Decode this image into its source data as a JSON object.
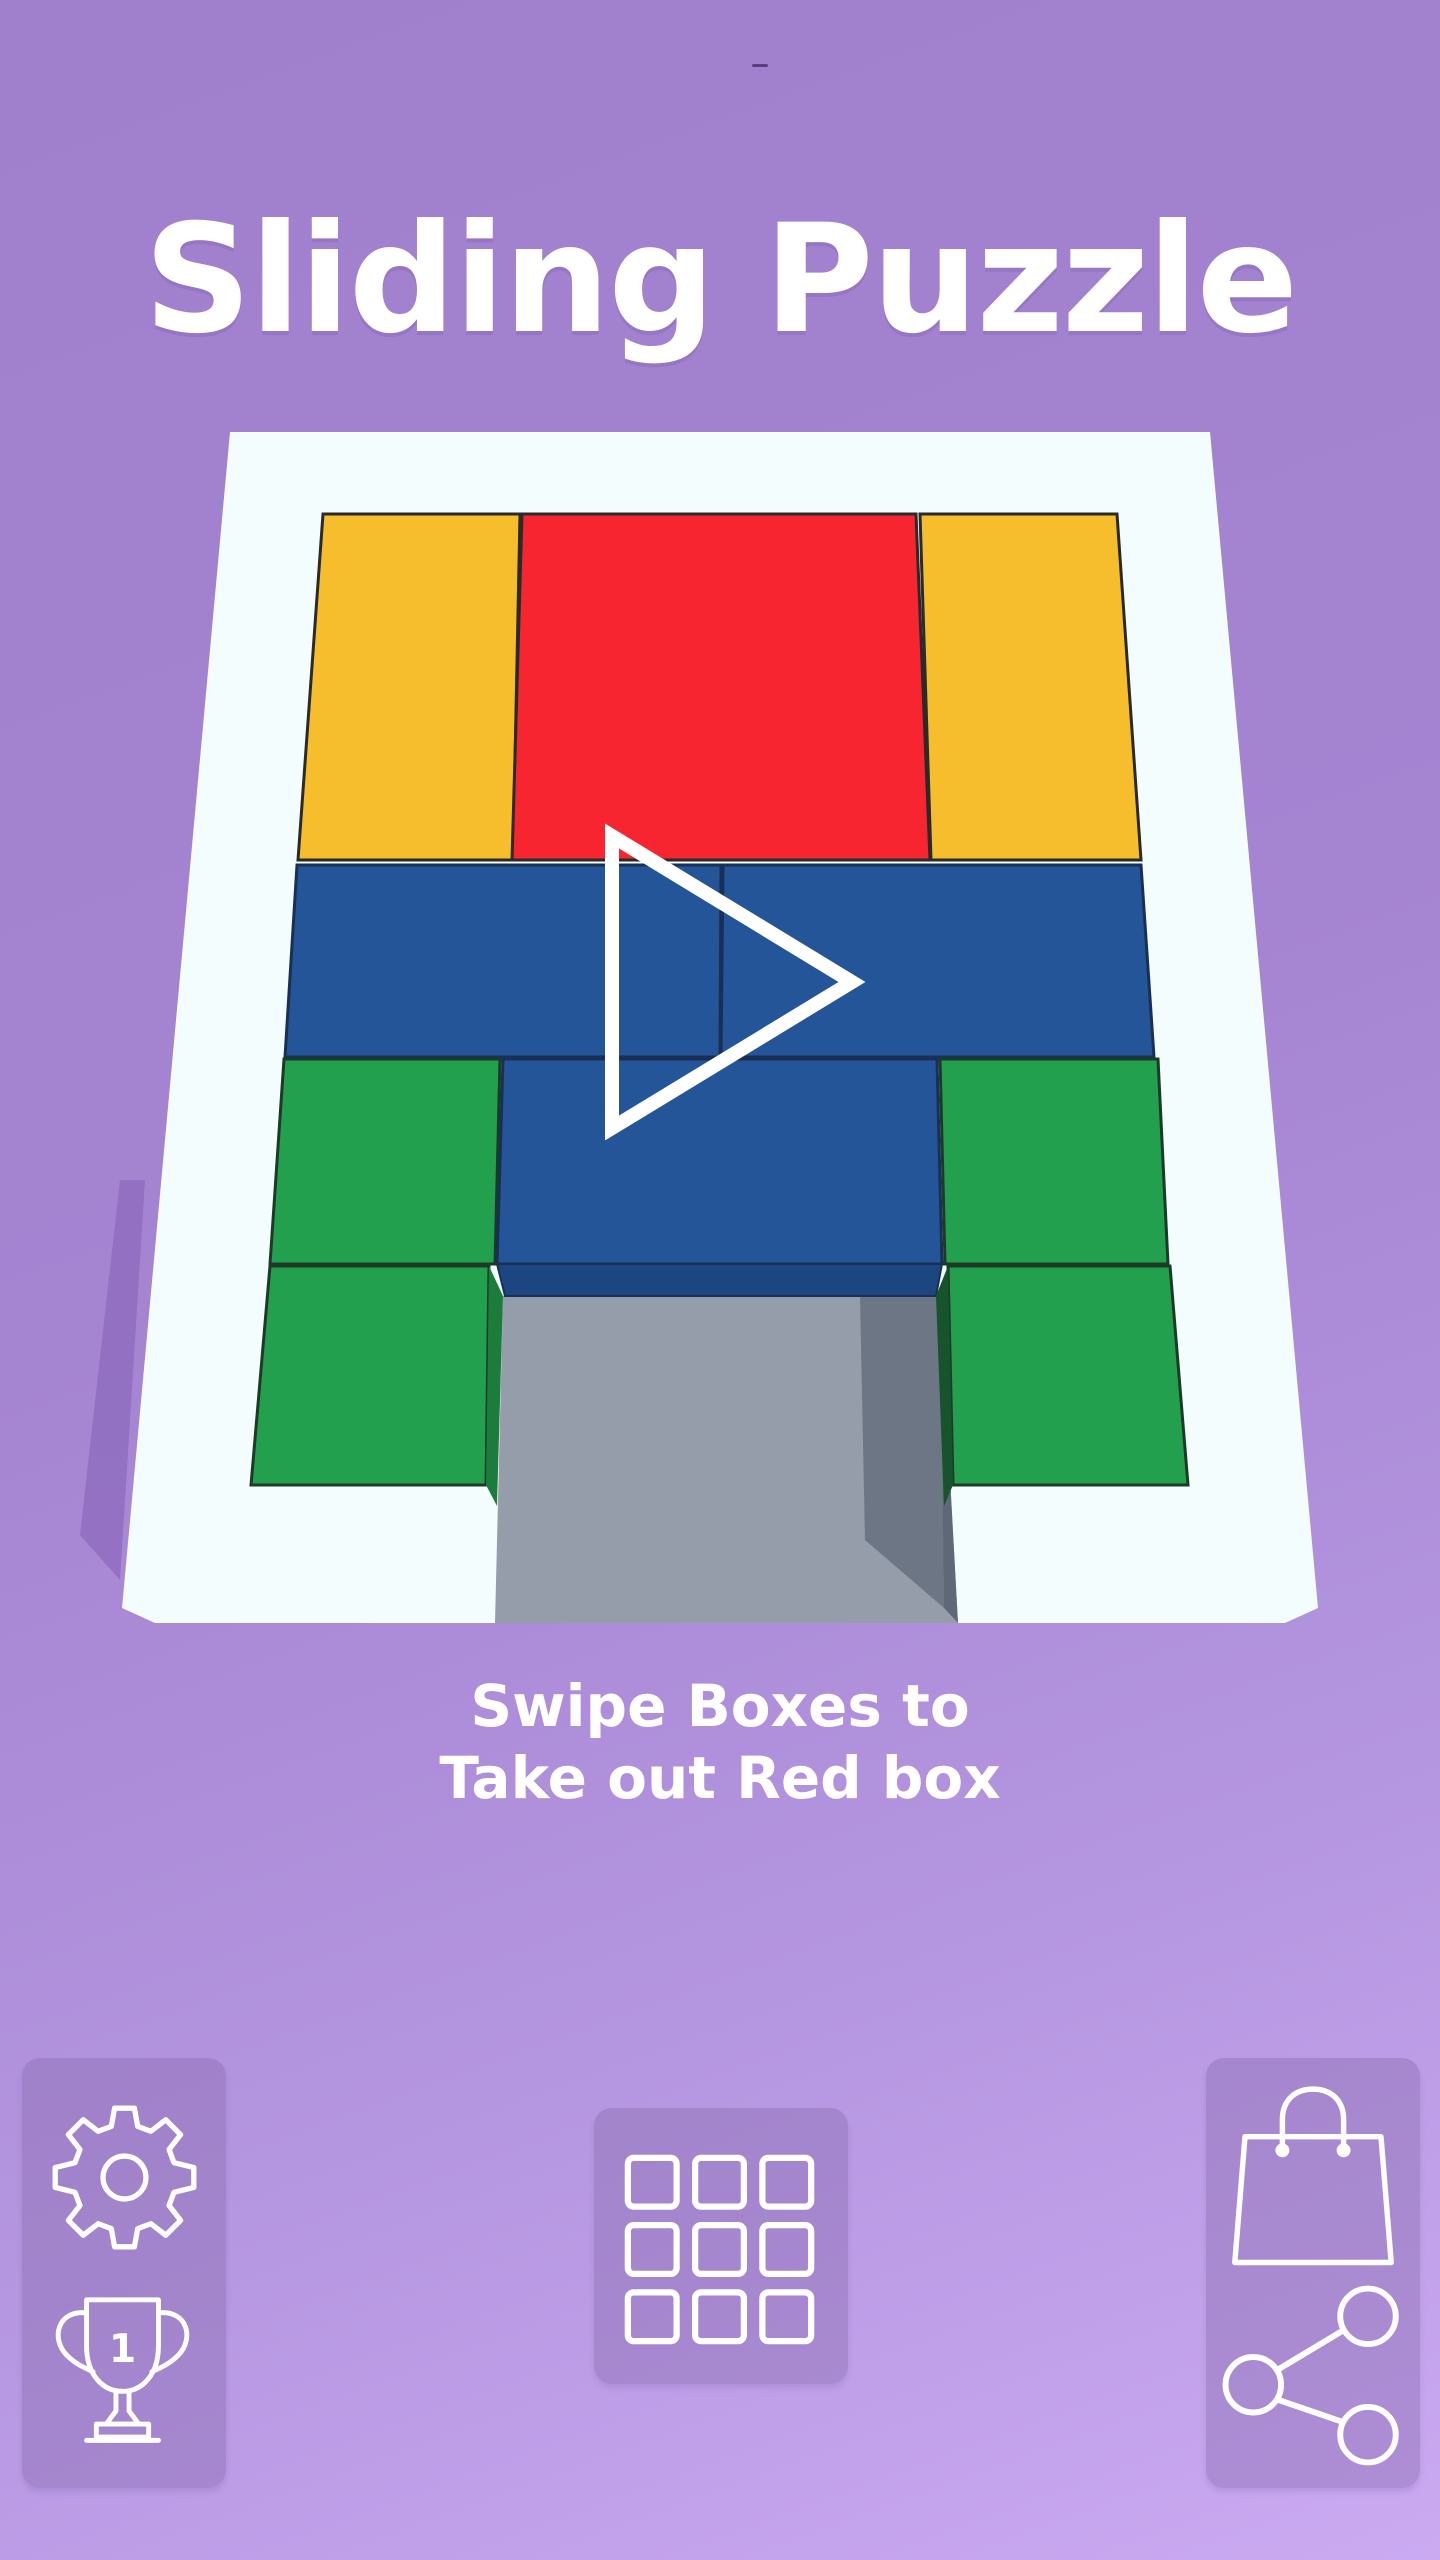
{
  "title": "Sliding Puzzle",
  "instructions": {
    "line1": "Swipe Boxes to",
    "line2": "Take out Red box"
  },
  "board": {
    "blocks": [
      {
        "name": "yellow-block-left",
        "color": "#f6bd2c"
      },
      {
        "name": "red-block-target",
        "color": "#f6252f"
      },
      {
        "name": "yellow-block-right",
        "color": "#f6bd2c"
      },
      {
        "name": "blue-block-top-left",
        "color": "#235598"
      },
      {
        "name": "blue-block-top-right",
        "color": "#235598"
      },
      {
        "name": "blue-block-center",
        "color": "#235598"
      },
      {
        "name": "green-block-left-upper",
        "color": "#22a04d"
      },
      {
        "name": "green-block-left-lower",
        "color": "#22a04d"
      },
      {
        "name": "green-block-right-upper",
        "color": "#22a04d"
      },
      {
        "name": "green-block-right-lower",
        "color": "#22a04d"
      }
    ],
    "frame_color": "#f3fdfd",
    "exit_color": "#959daa"
  },
  "buttons": {
    "play": "play-icon",
    "settings": "gear-icon",
    "leaderboard": "trophy-icon",
    "leaderboard_rank": "1",
    "levels": "grid-icon",
    "shop": "shopping-bag-icon",
    "share": "share-icon"
  },
  "colors": {
    "background": "#a584d2",
    "accent": "#ffffff"
  }
}
